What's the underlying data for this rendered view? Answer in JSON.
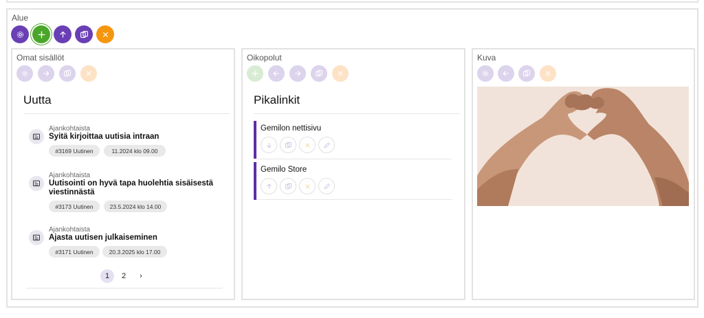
{
  "area": {
    "label": "Alue",
    "toolbar": [
      {
        "name": "settings-button",
        "icon": "gear-icon",
        "color": "#6a3fb5"
      },
      {
        "name": "add-button",
        "icon": "plus-icon",
        "color": "#4aa62a"
      },
      {
        "name": "move-up-button",
        "icon": "arrow-up-icon",
        "color": "#6a3fb5"
      },
      {
        "name": "copy-button",
        "icon": "copy-icon",
        "color": "#6a3fb5"
      },
      {
        "name": "close-button",
        "icon": "close-icon",
        "color": "#f5960f"
      }
    ]
  },
  "panels": {
    "own": {
      "label": "Omat sisällöt",
      "title": "Uutta",
      "news": [
        {
          "category": "Ajankohtaista",
          "title": "Syitä kirjoittaa uutisia intraan",
          "id_tag": "#3169 Uutinen",
          "date_tag": "11.2024 klo 09.00"
        },
        {
          "category": "Ajankohtaista",
          "title": "Uutisointi on hyvä tapa huolehtia sisäisestä viestinnästä",
          "id_tag": "#3173 Uutinen",
          "date_tag": "23.5.2024 klo 14.00"
        },
        {
          "category": "Ajankohtaista",
          "title": "Ajasta uutisen julkaiseminen",
          "id_tag": "#3171 Uutinen",
          "date_tag": "20.3.2025 klo 17.00"
        }
      ],
      "pagination": {
        "pages": [
          "1",
          "2"
        ],
        "current": "1",
        "next": "›"
      }
    },
    "shortcuts": {
      "label": "Oikopolut",
      "title": "Pikalinkit",
      "links": [
        {
          "title": "Gemilon nettisivu"
        },
        {
          "title": "Gemilo Store"
        }
      ]
    },
    "image": {
      "label": "Kuva"
    }
  },
  "colors": {
    "accent_purple": "#6a3fb5",
    "accent_green": "#4aa62a",
    "accent_orange": "#f5960f",
    "link_bar": "#5b2ea6"
  }
}
